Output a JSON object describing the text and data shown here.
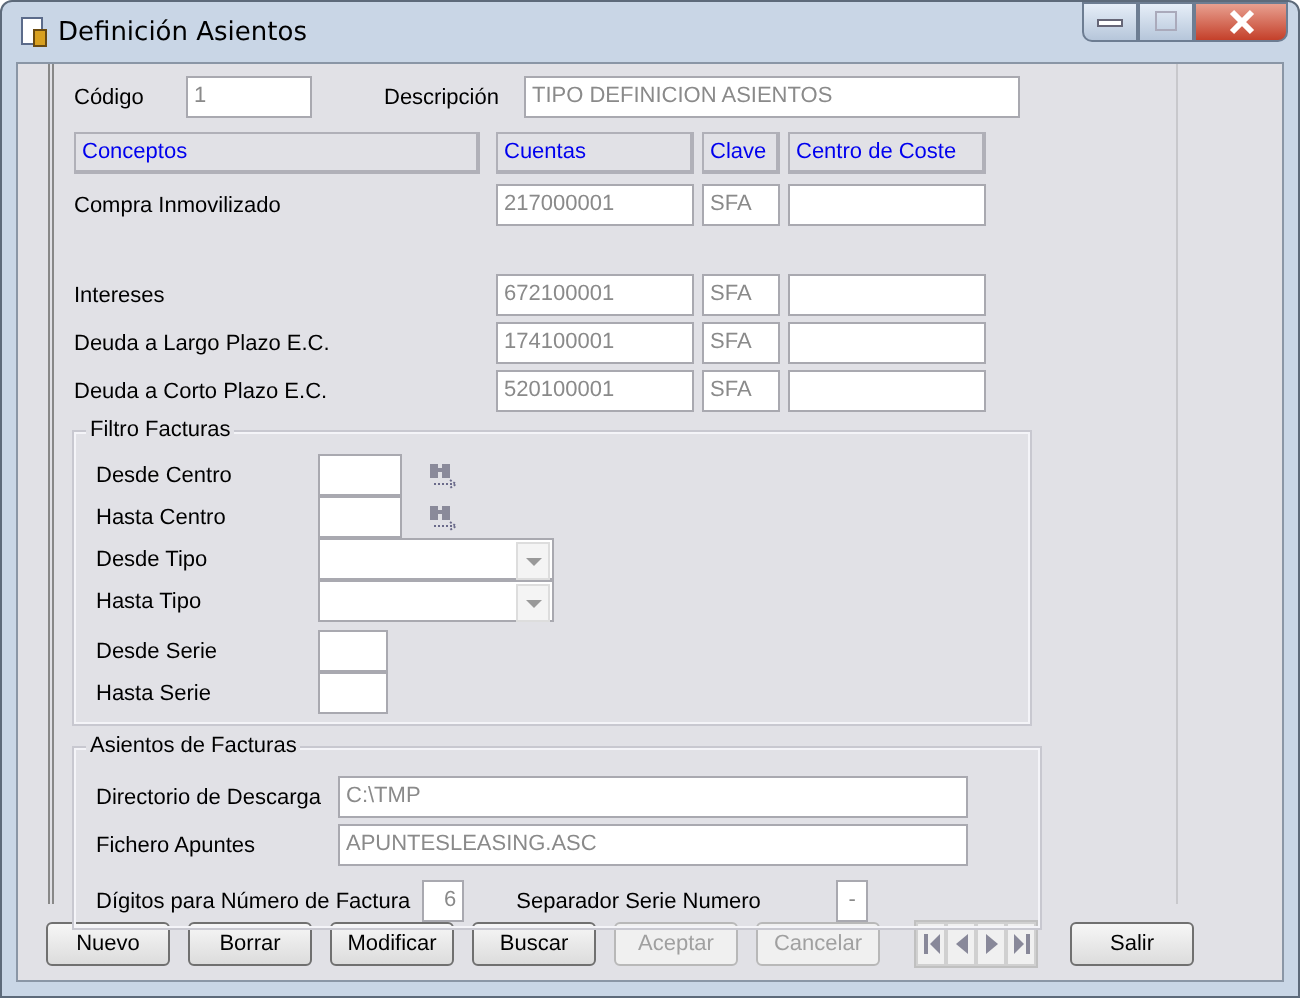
{
  "window": {
    "title": "Definición Asientos"
  },
  "header": {
    "code": {
      "label": "Código",
      "value": "1"
    },
    "description": {
      "label": "Descripción",
      "value": "TIPO DEFINICION ASIENTOS"
    }
  },
  "columns": [
    "Conceptos",
    "Cuentas",
    "Clave",
    "Centro de Coste"
  ],
  "rows": [
    {
      "concept": "Compra Inmovilizado",
      "account": "217000001",
      "key": "SFA",
      "cost_center": ""
    },
    {
      "concept": "Intereses",
      "account": "672100001",
      "key": "SFA",
      "cost_center": ""
    },
    {
      "concept": "Deuda a Largo Plazo E.C.",
      "account": "174100001",
      "key": "SFA",
      "cost_center": ""
    },
    {
      "concept": "Deuda a Corto Plazo E.C.",
      "account": "520100001",
      "key": "SFA",
      "cost_center": ""
    }
  ],
  "invoice_filter": {
    "title": "Filtro Facturas",
    "fields": [
      {
        "label": "Desde Centro",
        "kind": "lookup"
      },
      {
        "label": "Hasta Centro",
        "kind": "lookup"
      },
      {
        "label": "Desde Tipo",
        "kind": "combo"
      },
      {
        "label": "Hasta Tipo",
        "kind": "combo"
      },
      {
        "label": "Desde Serie",
        "kind": "short"
      },
      {
        "label": "Hasta Serie",
        "kind": "short"
      }
    ]
  },
  "invoice_entries": {
    "title": "Asientos de Facturas",
    "directory": {
      "label": "Directorio de Descarga",
      "value": "C:\\TMP"
    },
    "file": {
      "label": "Fichero Apuntes",
      "value": "APUNTESLEASING.ASC"
    },
    "digits": {
      "label": "Dígitos para Número de Factura",
      "value": "6"
    },
    "separator": {
      "label": "Separador Serie Numero",
      "value": "-"
    }
  },
  "buttons": [
    {
      "label": "Nuevo",
      "disabled": false
    },
    {
      "label": "Borrar",
      "disabled": false
    },
    {
      "label": "Modificar",
      "disabled": false
    },
    {
      "label": "Buscar",
      "disabled": false
    },
    {
      "label": "Aceptar",
      "disabled": true
    },
    {
      "label": "Cancelar",
      "disabled": true
    }
  ],
  "exit_button": {
    "label": "Salir",
    "disabled": false
  }
}
